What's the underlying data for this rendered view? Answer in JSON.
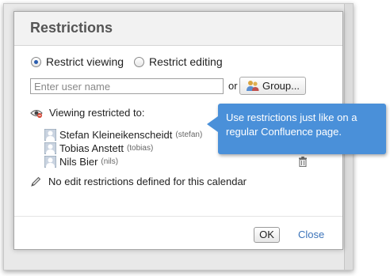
{
  "dialog": {
    "title": "Restrictions"
  },
  "radios": {
    "restrict_viewing": "Restrict viewing",
    "restrict_editing": "Restrict editing",
    "selected": "restrict_viewing"
  },
  "user_search": {
    "placeholder": "Enter user name",
    "value": "",
    "or_label": "or",
    "group_button_label": "Group..."
  },
  "viewing": {
    "label": "Viewing restricted to:",
    "users": [
      {
        "full_name": "Stefan Kleineikenscheidt",
        "username": "(stefan)"
      },
      {
        "full_name": "Tobias Anstett",
        "username": "(tobias)"
      },
      {
        "full_name": "Nils Bier",
        "username": "(nils)"
      }
    ]
  },
  "editing": {
    "label": "No edit restrictions defined for this calendar"
  },
  "footer": {
    "ok_label": "OK",
    "close_label": "Close"
  },
  "callout": {
    "text": "Use restrictions just like on a regular Confluence page."
  },
  "colors": {
    "callout": "#4a90d9",
    "link": "#3b73b9"
  }
}
